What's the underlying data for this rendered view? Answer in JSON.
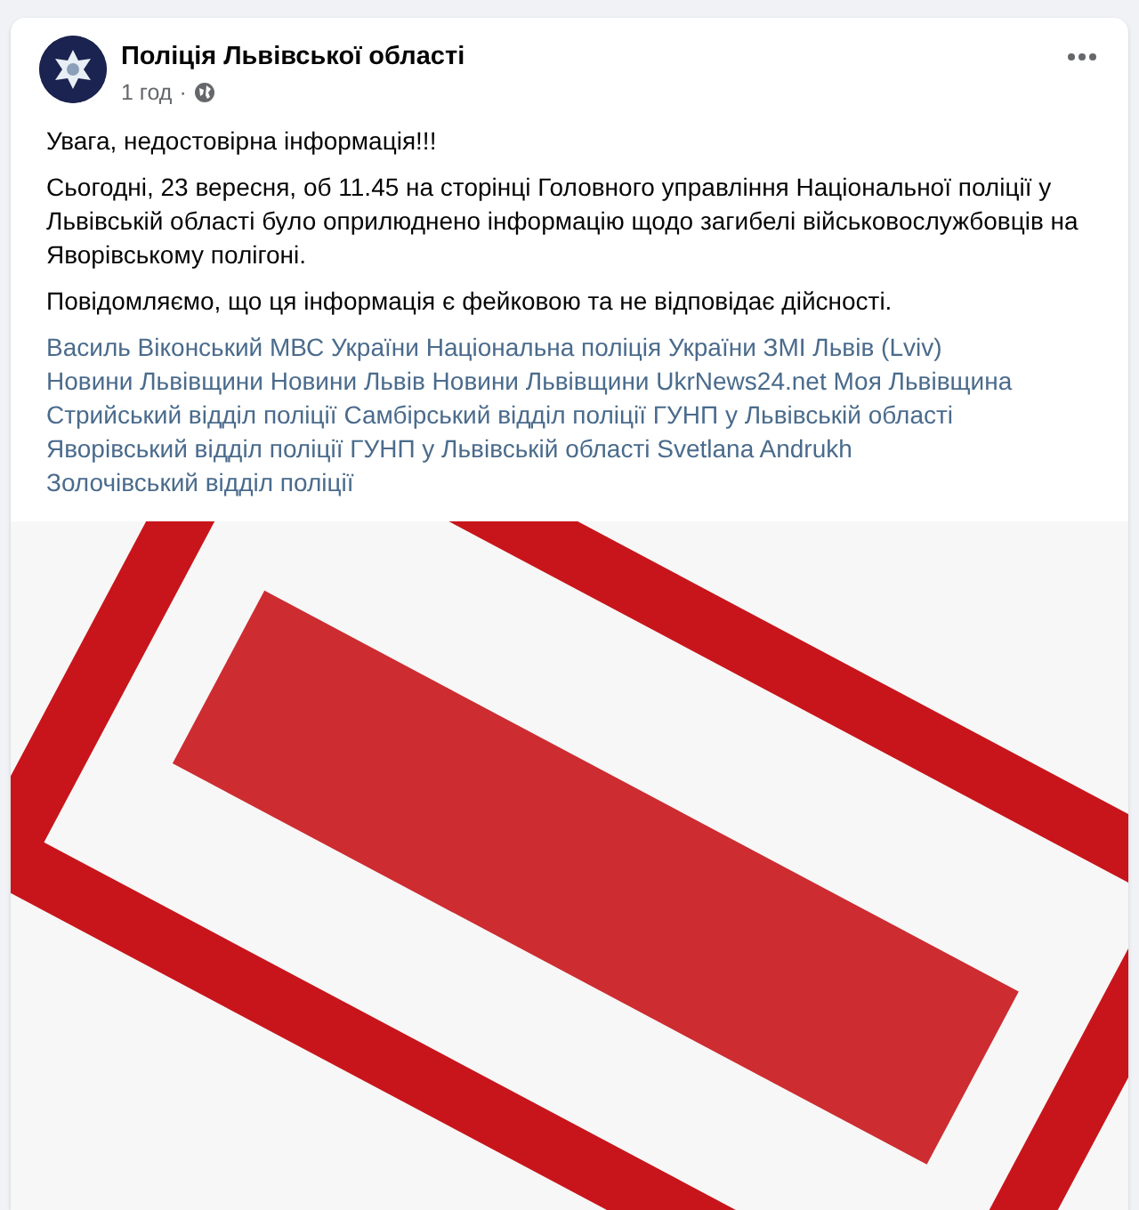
{
  "post": {
    "author": "Поліція Львівської області",
    "time": "1 год",
    "separator": "·",
    "paragraphs": [
      "Увага, недостовірна інформація!!!",
      "Сьогодні, 23 вересня, об 11.45 на сторінці Головного управління Національної поліції у Львівській області було оприлюднено інформацію щодо загибелі військовослужбовців на Яворівському полігоні.",
      "Повідомляємо, що ця інформація є фейковою та не відповідає дійсності."
    ],
    "tags": [
      "Василь Віконський",
      "МВС України",
      "Національна поліція України",
      "ЗМІ Львів (Lviv)",
      "Новини Львівщини",
      "Новини Львів",
      "Новини Львівщини",
      "UkrNews24.net",
      "Моя Львівщина",
      "Стрийський відділ поліції",
      "Самбірський відділ поліції",
      "ГУНП у Львівській області",
      "Яворівський відділ поліції",
      "ГУНП у Львівській області",
      "Svetlana Andrukh",
      "Золочівський відділ поліції"
    ]
  }
}
